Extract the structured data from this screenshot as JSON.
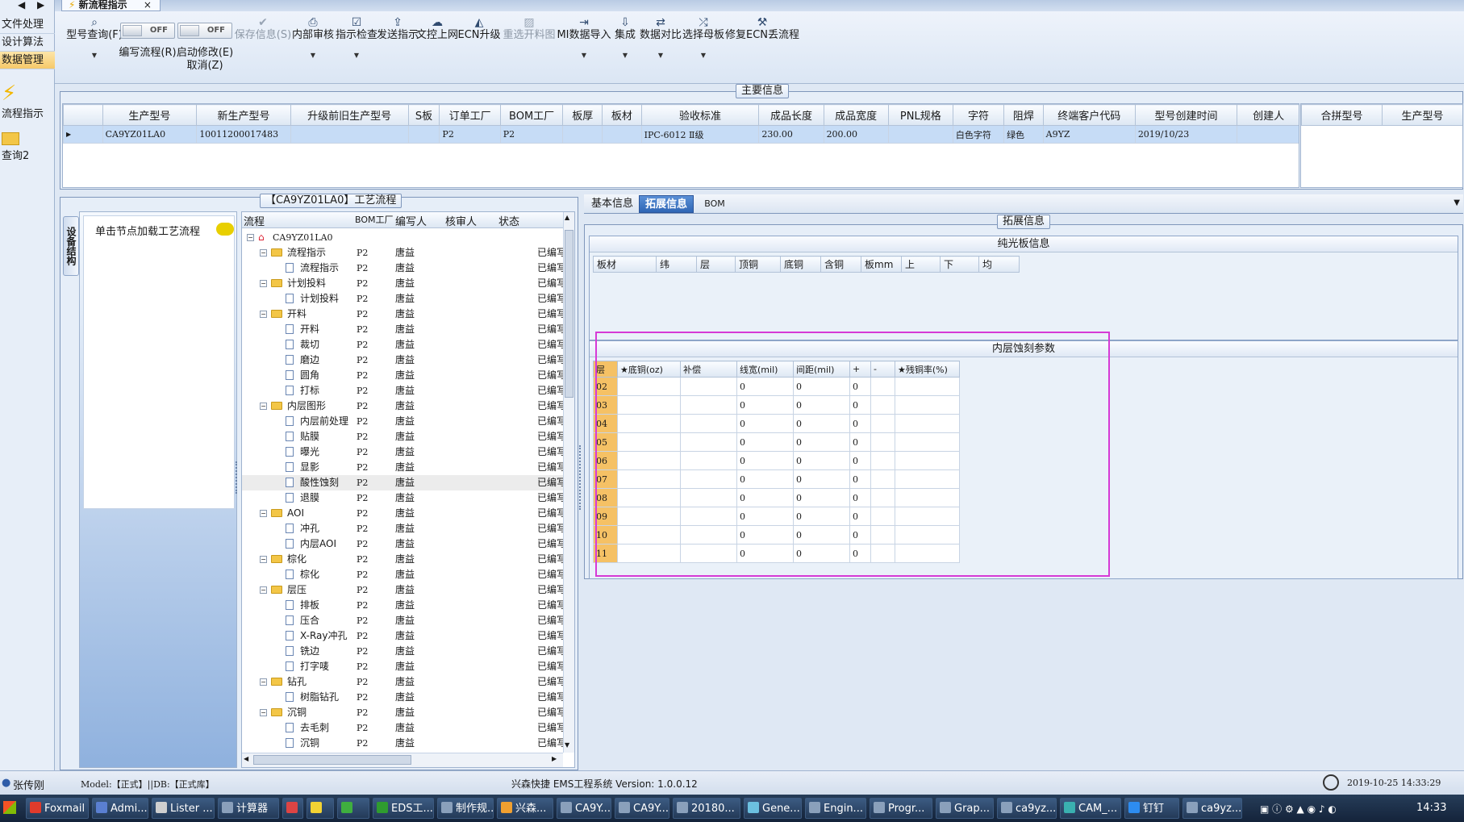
{
  "left_nav": {
    "items": [
      {
        "label": "文件处理",
        "active": false
      },
      {
        "label": "设计算法",
        "active": false
      },
      {
        "label": "数据管理",
        "active": true
      }
    ],
    "big_items": [
      "流程指示",
      "查询2"
    ]
  },
  "document_tab": {
    "title": "新流程指示",
    "close": "×"
  },
  "toolbar": {
    "buttons": [
      {
        "label": "型号查询(F)",
        "icon": "search-icon",
        "has_dropdown": true,
        "disabled": false
      },
      {
        "label": "编写流程(R)",
        "toggle": "OFF"
      },
      {
        "label": "启动修改(E)",
        "label2": "取消(Z)",
        "toggle": "OFF"
      },
      {
        "label": "保存信息(S)",
        "icon": "check-icon",
        "disabled": true
      },
      {
        "label": "内部审核",
        "icon": "printer-icon",
        "has_dropdown": true
      },
      {
        "label": "指示检查",
        "icon": "checklist-icon",
        "has_dropdown": true
      },
      {
        "label": "发送指示",
        "icon": "upload-icon"
      },
      {
        "label": "文控上网",
        "icon": "cloud-icon"
      },
      {
        "label": "ECN升级",
        "icon": "ecn-icon"
      },
      {
        "label": "重选开料图",
        "icon": "image-icon",
        "disabled": true
      },
      {
        "label": "MI数据导入",
        "icon": "import-icon",
        "has_dropdown": true
      },
      {
        "label": "集成",
        "icon": "download-icon",
        "has_dropdown": true
      },
      {
        "label": "数据对比",
        "icon": "compare-icon",
        "has_dropdown": true
      },
      {
        "label": "选择母板",
        "icon": "shuffle-icon",
        "has_dropdown": true
      },
      {
        "label": "修复ECN丢流程",
        "icon": "wrench-icon"
      }
    ]
  },
  "main_info": {
    "caption": "主要信息",
    "columns": [
      "生产型号",
      "新生产型号",
      "升级前旧生产型号",
      "S板",
      "订单工厂",
      "BOM工厂",
      "板厚",
      "板材",
      "验收标准",
      "成品长度",
      "成品宽度",
      "PNL规格",
      "字符",
      "阻焊",
      "终端客户代码",
      "型号创建时间",
      "创建人"
    ],
    "rows": [
      [
        "CA9YZ01LA0",
        "10011200017483",
        "",
        "",
        "P2",
        "P2",
        "",
        "",
        "IPC-6012 Ⅱ级",
        "230.00",
        "200.00",
        "",
        "白色字符",
        "绿色",
        "A9YZ",
        "2019/10/23",
        ""
      ]
    ],
    "right_columns": [
      "合拼型号",
      "生产型号"
    ]
  },
  "process": {
    "caption": "【CA9YZ01LA0】工艺流程",
    "side_tab": "设备结构",
    "hint": "单击节点加载工艺流程",
    "columns": [
      "流程",
      "BOM工厂",
      "编写人",
      "核审人",
      "状态"
    ],
    "root": "CA9YZ01LA0",
    "nodes": [
      {
        "name": "流程指示",
        "level": 1,
        "bom": "P2",
        "author": "唐益",
        "status": "已编写"
      },
      {
        "name": "流程指示",
        "level": 2,
        "bom": "P2",
        "author": "唐益",
        "status": "已编写"
      },
      {
        "name": "计划投料",
        "level": 1,
        "bom": "P2",
        "author": "唐益",
        "status": "已编写"
      },
      {
        "name": "计划投料",
        "level": 2,
        "bom": "P2",
        "author": "唐益",
        "status": "已编写"
      },
      {
        "name": "开料",
        "level": 1,
        "bom": "P2",
        "author": "唐益",
        "status": "已编写"
      },
      {
        "name": "开料",
        "level": 2,
        "bom": "P2",
        "author": "唐益",
        "status": "已编写"
      },
      {
        "name": "裁切",
        "level": 2,
        "bom": "P2",
        "author": "唐益",
        "status": "已编写"
      },
      {
        "name": "磨边",
        "level": 2,
        "bom": "P2",
        "author": "唐益",
        "status": "已编写"
      },
      {
        "name": "圆角",
        "level": 2,
        "bom": "P2",
        "author": "唐益",
        "status": "已编写"
      },
      {
        "name": "打标",
        "level": 2,
        "bom": "P2",
        "author": "唐益",
        "status": "已编写"
      },
      {
        "name": "内层图形",
        "level": 1,
        "bom": "P2",
        "author": "唐益",
        "status": "已编写"
      },
      {
        "name": "内层前处理",
        "level": 2,
        "bom": "P2",
        "author": "唐益",
        "status": "已编写"
      },
      {
        "name": "贴膜",
        "level": 2,
        "bom": "P2",
        "author": "唐益",
        "status": "已编写"
      },
      {
        "name": "曝光",
        "level": 2,
        "bom": "P2",
        "author": "唐益",
        "status": "已编写"
      },
      {
        "name": "显影",
        "level": 2,
        "bom": "P2",
        "author": "唐益",
        "status": "已编写"
      },
      {
        "name": "酸性蚀刻",
        "level": 2,
        "bom": "P2",
        "author": "唐益",
        "status": "已编写",
        "selected": true
      },
      {
        "name": "退膜",
        "level": 2,
        "bom": "P2",
        "author": "唐益",
        "status": "已编写"
      },
      {
        "name": "AOI",
        "level": 1,
        "bom": "P2",
        "author": "唐益",
        "status": "已编写"
      },
      {
        "name": "冲孔",
        "level": 2,
        "bom": "P2",
        "author": "唐益",
        "status": "已编写"
      },
      {
        "name": "内层AOI",
        "level": 2,
        "bom": "P2",
        "author": "唐益",
        "status": "已编写"
      },
      {
        "name": "棕化",
        "level": 1,
        "bom": "P2",
        "author": "唐益",
        "status": "已编写"
      },
      {
        "name": "棕化",
        "level": 2,
        "bom": "P2",
        "author": "唐益",
        "status": "已编写"
      },
      {
        "name": "层压",
        "level": 1,
        "bom": "P2",
        "author": "唐益",
        "status": "已编写"
      },
      {
        "name": "排板",
        "level": 2,
        "bom": "P2",
        "author": "唐益",
        "status": "已编写"
      },
      {
        "name": "压合",
        "level": 2,
        "bom": "P2",
        "author": "唐益",
        "status": "已编写"
      },
      {
        "name": "X-Ray冲孔",
        "level": 2,
        "bom": "P2",
        "author": "唐益",
        "status": "已编写"
      },
      {
        "name": "铣边",
        "level": 2,
        "bom": "P2",
        "author": "唐益",
        "status": "已编写"
      },
      {
        "name": "打字唛",
        "level": 2,
        "bom": "P2",
        "author": "唐益",
        "status": "已编写"
      },
      {
        "name": "钻孔",
        "level": 1,
        "bom": "P2",
        "author": "唐益",
        "status": "已编写"
      },
      {
        "name": "树脂钻孔",
        "level": 2,
        "bom": "P2",
        "author": "唐益",
        "status": "已编写"
      },
      {
        "name": "沉铜",
        "level": 1,
        "bom": "P2",
        "author": "唐益",
        "status": "已编写"
      },
      {
        "name": "去毛刺",
        "level": 2,
        "bom": "P2",
        "author": "唐益",
        "status": "已编写"
      },
      {
        "name": "沉铜",
        "level": 2,
        "bom": "P2",
        "author": "唐益",
        "status": "已编写"
      }
    ]
  },
  "right_tabs": {
    "tabs": [
      {
        "label": "基本信息",
        "active": false
      },
      {
        "label": "拓展信息",
        "active": true
      },
      {
        "label": "BOM",
        "active": false
      }
    ],
    "caption": "拓展信息"
  },
  "light_board": {
    "title": "纯光板信息",
    "columns": [
      "板材",
      "纬",
      "层",
      "顶铜",
      "底铜",
      "含铜",
      "板mm",
      "上",
      "下",
      "均"
    ]
  },
  "inner_etch": {
    "title": "内层蚀刻参数",
    "columns": [
      "层",
      "★底铜(oz)",
      "补偿",
      "线宽(mil)",
      "间距(mil)",
      "+",
      "-",
      "★残铜率(%)"
    ],
    "rows": [
      [
        "02",
        "",
        "",
        "0",
        "0",
        "0",
        "",
        ""
      ],
      [
        "03",
        "",
        "",
        "0",
        "0",
        "0",
        "",
        ""
      ],
      [
        "04",
        "",
        "",
        "0",
        "0",
        "0",
        "",
        ""
      ],
      [
        "05",
        "",
        "",
        "0",
        "0",
        "0",
        "",
        ""
      ],
      [
        "06",
        "",
        "",
        "0",
        "0",
        "0",
        "",
        ""
      ],
      [
        "07",
        "",
        "",
        "0",
        "0",
        "0",
        "",
        ""
      ],
      [
        "08",
        "",
        "",
        "0",
        "0",
        "0",
        "",
        ""
      ],
      [
        "09",
        "",
        "",
        "0",
        "0",
        "0",
        "",
        ""
      ],
      [
        "10",
        "",
        "",
        "0",
        "0",
        "0",
        "",
        ""
      ],
      [
        "11",
        "",
        "",
        "0",
        "0",
        "0",
        "",
        ""
      ]
    ],
    "highlight_color": "#d63ad6"
  },
  "status_bar": {
    "user": "张传刚",
    "model": "Model:【正式】||DB:【正式库】",
    "system": "兴森快捷 EMS工程系统 Version: 1.0.0.12",
    "datetime": "2019-10-25 14:33:29"
  },
  "taskbar": {
    "items": [
      {
        "label": "Foxmail",
        "color": "#e03b2c"
      },
      {
        "label": "Admi...",
        "color": "#5a7fd1"
      },
      {
        "label": "Lister ...",
        "color": "#cfcfcf"
      },
      {
        "label": "计算器",
        "color": "#8aa0bb"
      },
      {
        "label": "",
        "color": "#d44"
      },
      {
        "label": "",
        "color": "#f2d233"
      },
      {
        "label": "",
        "color": "#3fae3f"
      },
      {
        "label": "EDS工...",
        "color": "#2f9c2f"
      },
      {
        "label": "制作规...",
        "color": "#8aa0bb"
      },
      {
        "label": "兴森...",
        "color": "#f0a030"
      },
      {
        "label": "CA9Y...",
        "color": "#8aa0bb"
      },
      {
        "label": "CA9Y...",
        "color": "#8aa0bb"
      },
      {
        "label": "20180...",
        "color": "#8aa0bb"
      },
      {
        "label": "Gene...",
        "color": "#6cc0e0"
      },
      {
        "label": "Engin...",
        "color": "#8aa0bb"
      },
      {
        "label": "Progr...",
        "color": "#8aa0bb"
      },
      {
        "label": "Grap...",
        "color": "#8aa0bb"
      },
      {
        "label": "ca9yz...",
        "color": "#8aa0bb"
      },
      {
        "label": "CAM_...",
        "color": "#3ab0b0"
      },
      {
        "label": "钉钉",
        "color": "#2d8cf0"
      },
      {
        "label": "ca9yz...",
        "color": "#8aa0bb"
      }
    ],
    "clock": "14:33"
  }
}
